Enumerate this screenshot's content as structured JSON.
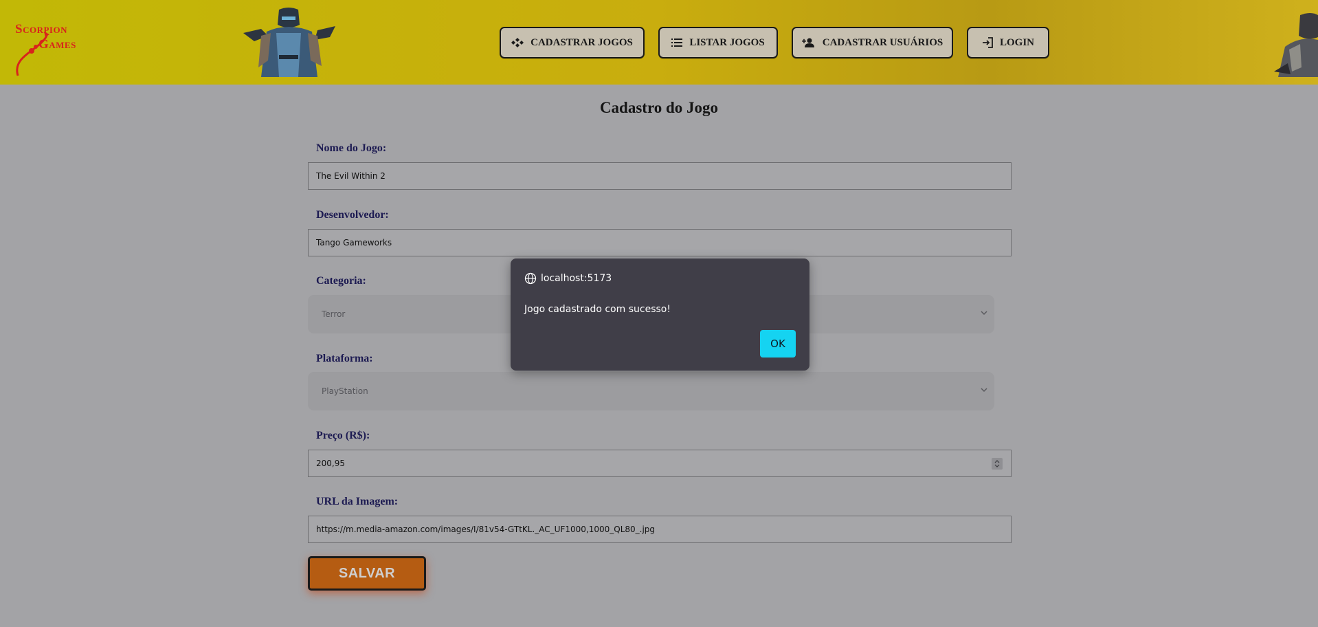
{
  "header": {
    "logo": {
      "line1": "Scorpion",
      "line2": "Games"
    },
    "nav": [
      {
        "label": "CADASTRAR JOGOS",
        "icon": "gamepad-icon"
      },
      {
        "label": "LISTAR JOGOS",
        "icon": "list-icon"
      },
      {
        "label": "CADASTRAR USUÁRIOS",
        "icon": "add-user-icon"
      },
      {
        "label": "LOGIN",
        "icon": "login-icon"
      }
    ]
  },
  "form": {
    "title": "Cadastro do Jogo",
    "name_label": "Nome do Jogo:",
    "name_value": "The Evil Within 2",
    "developer_label": "Desenvolvedor:",
    "developer_value": "Tango Gameworks",
    "category_label": "Categoria:",
    "category_value": "Terror",
    "platform_label": "Plataforma:",
    "platform_value": "PlayStation",
    "price_label": "Preço (R$):",
    "price_value": "200,95",
    "image_label": "URL da Imagem:",
    "image_value": "https://m.media-amazon.com/images/I/81v54-GTtKL._AC_UF1000,1000_QL80_.jpg",
    "save_label": "SALVAR"
  },
  "dialog": {
    "origin": "localhost:5173",
    "message": "Jogo cadastrado com sucesso!",
    "ok_label": "OK"
  },
  "colors": {
    "header_yellow": "#c2b806",
    "save_orange": "#b55c12",
    "ok_cyan": "#15d3f1",
    "label_navy": "#1d1b52"
  }
}
